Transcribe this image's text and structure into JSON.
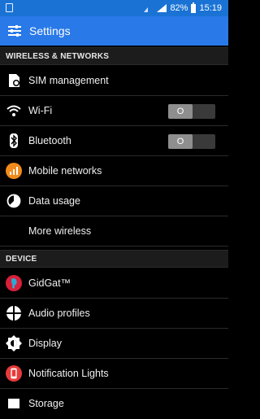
{
  "status": {
    "battery": "82%",
    "time": "15:19"
  },
  "appbar": {
    "title": "Settings"
  },
  "sections": {
    "wireless": "WIRELESS & NETWORKS",
    "device": "DEVICE"
  },
  "items": {
    "sim": "SIM management",
    "wifi": "Wi-Fi",
    "wifi_toggle": "O",
    "bluetooth": "Bluetooth",
    "bluetooth_toggle": "O",
    "mobile": "Mobile networks",
    "data": "Data usage",
    "more": "More wireless",
    "gidgat": "GidGat™",
    "audio": "Audio profiles",
    "display": "Display",
    "notification": "Notification Lights",
    "storage": "Storage"
  }
}
